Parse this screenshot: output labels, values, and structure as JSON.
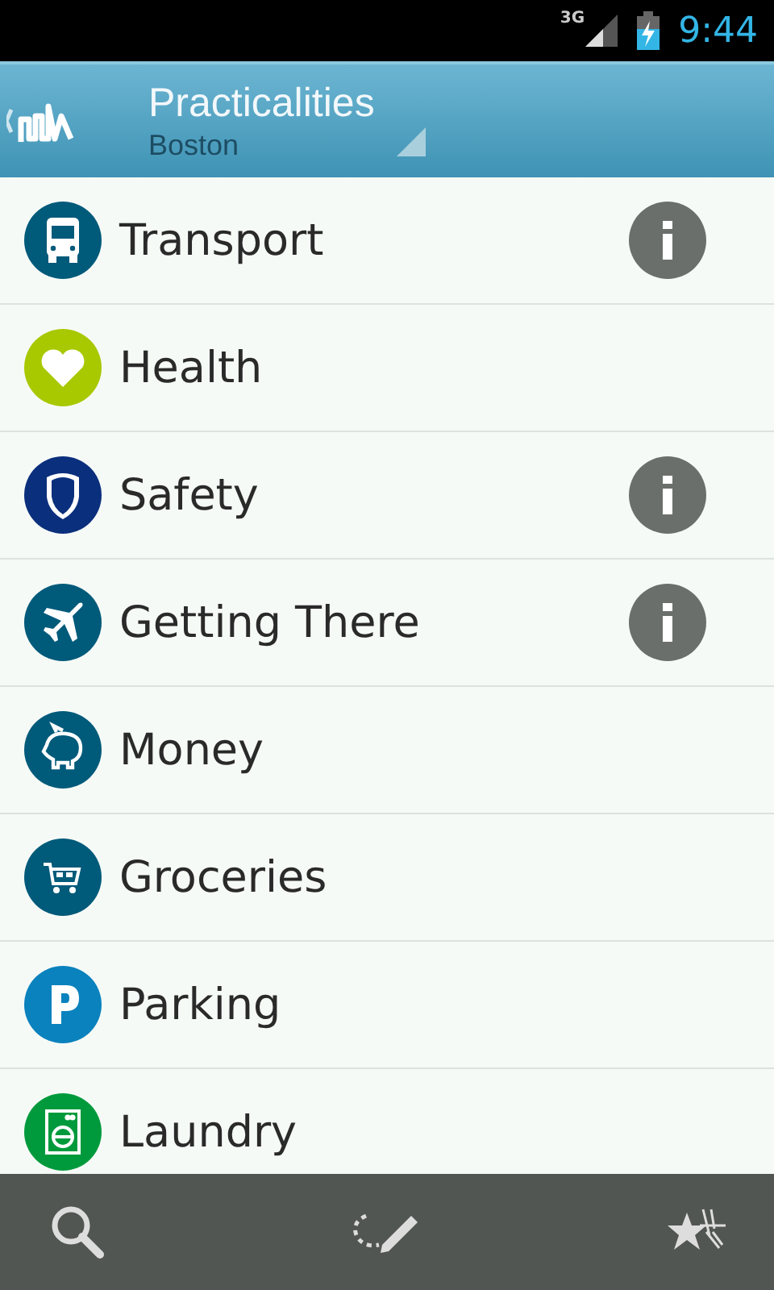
{
  "status_bar": {
    "network": "3G",
    "time": "9:44"
  },
  "header": {
    "title": "Practicalities",
    "subtitle": "Boston"
  },
  "items": [
    {
      "label": "Transport",
      "kind": "bus",
      "color": "#005a7a",
      "info": true
    },
    {
      "label": "Health",
      "kind": "heart",
      "color": "#a8c800",
      "info": false
    },
    {
      "label": "Safety",
      "kind": "shield",
      "color": "#0a2f7c",
      "info": true
    },
    {
      "label": "Getting There",
      "kind": "plane",
      "color": "#005a7a",
      "info": true
    },
    {
      "label": "Money",
      "kind": "piggy",
      "color": "#005a7a",
      "info": false
    },
    {
      "label": "Groceries",
      "kind": "cart",
      "color": "#005a7a",
      "info": false
    },
    {
      "label": "Parking",
      "kind": "parking",
      "color": "#0a82bd",
      "info": false
    },
    {
      "label": "Laundry",
      "kind": "washer",
      "color": "#009a3c",
      "info": false
    }
  ]
}
